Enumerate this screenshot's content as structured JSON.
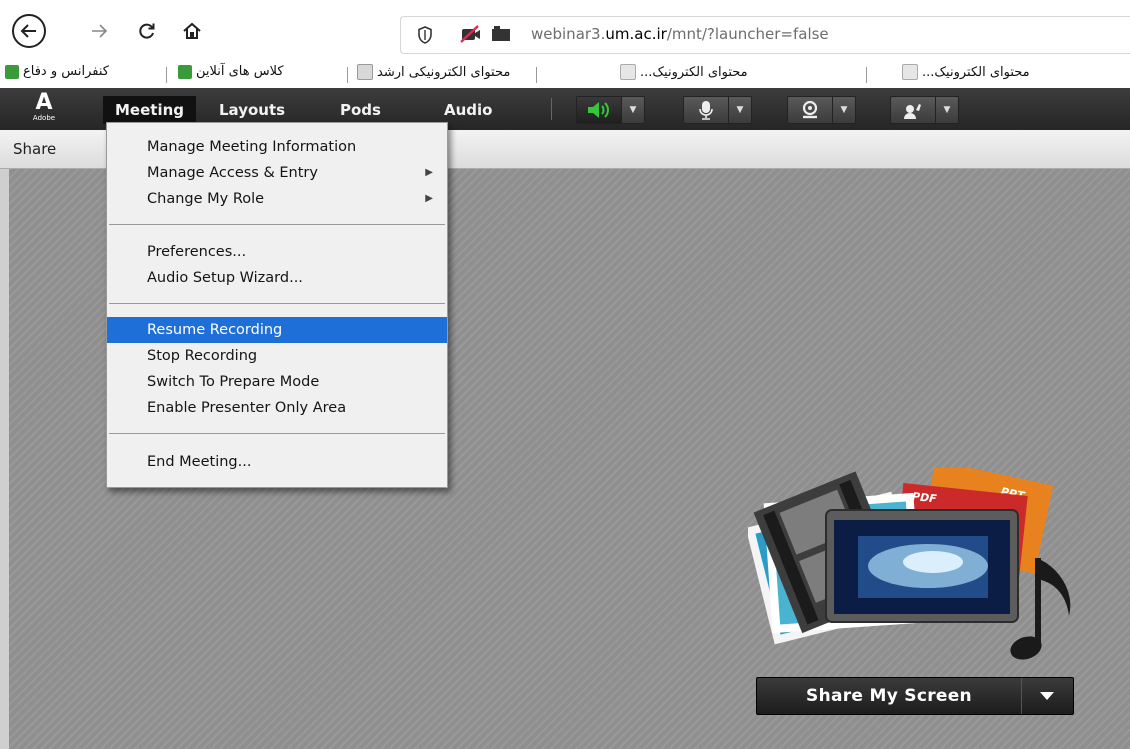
{
  "browser": {
    "url_prefix": "webinar3.",
    "url_domain": "um.ac.ir",
    "url_path": "/mnt/?launcher=false"
  },
  "bookmarks": [
    {
      "label": "کنفرانس و دفاع"
    },
    {
      "label": "کلاس های آنلاین"
    },
    {
      "label": "محتوای الکترونیکی ارشد"
    },
    {
      "label": "محتوای الکترونیک..."
    },
    {
      "label": "محتوای الکترونیک..."
    }
  ],
  "app": {
    "logo_text": "Adobe",
    "menus": [
      "Meeting",
      "Layouts",
      "Pods",
      "Audio"
    ]
  },
  "pod": {
    "title": "Share",
    "share_button_label": "Share My Screen",
    "art_labels": {
      "ppt": "PPT",
      "pdf": "PDF"
    }
  },
  "meeting_menu": {
    "items": [
      {
        "label": "Manage Meeting Information"
      },
      {
        "label": "Manage Access & Entry"
      },
      {
        "label": "Change My Role"
      },
      {
        "label": "Preferences..."
      },
      {
        "label": "Audio Setup Wizard..."
      },
      {
        "label": "Resume Recording"
      },
      {
        "label": "Stop Recording"
      },
      {
        "label": "Switch To Prepare Mode"
      },
      {
        "label": "Enable Presenter Only Area"
      },
      {
        "label": "End Meeting..."
      }
    ]
  },
  "colors": {
    "menu_highlight": "#1f6fd8",
    "speaker_green": "#35c63a",
    "bookmark_icon_green": "#3a9b3a"
  },
  "icons": [
    "back-arrow-icon",
    "forward-arrow-icon",
    "reload-icon",
    "home-icon",
    "shield-icon",
    "camera-blocked-icon",
    "speaker-icon",
    "microphone-icon",
    "webcam-icon",
    "raise-hand-icon",
    "chevron-down-icon",
    "submenu-arrow-icon"
  ]
}
